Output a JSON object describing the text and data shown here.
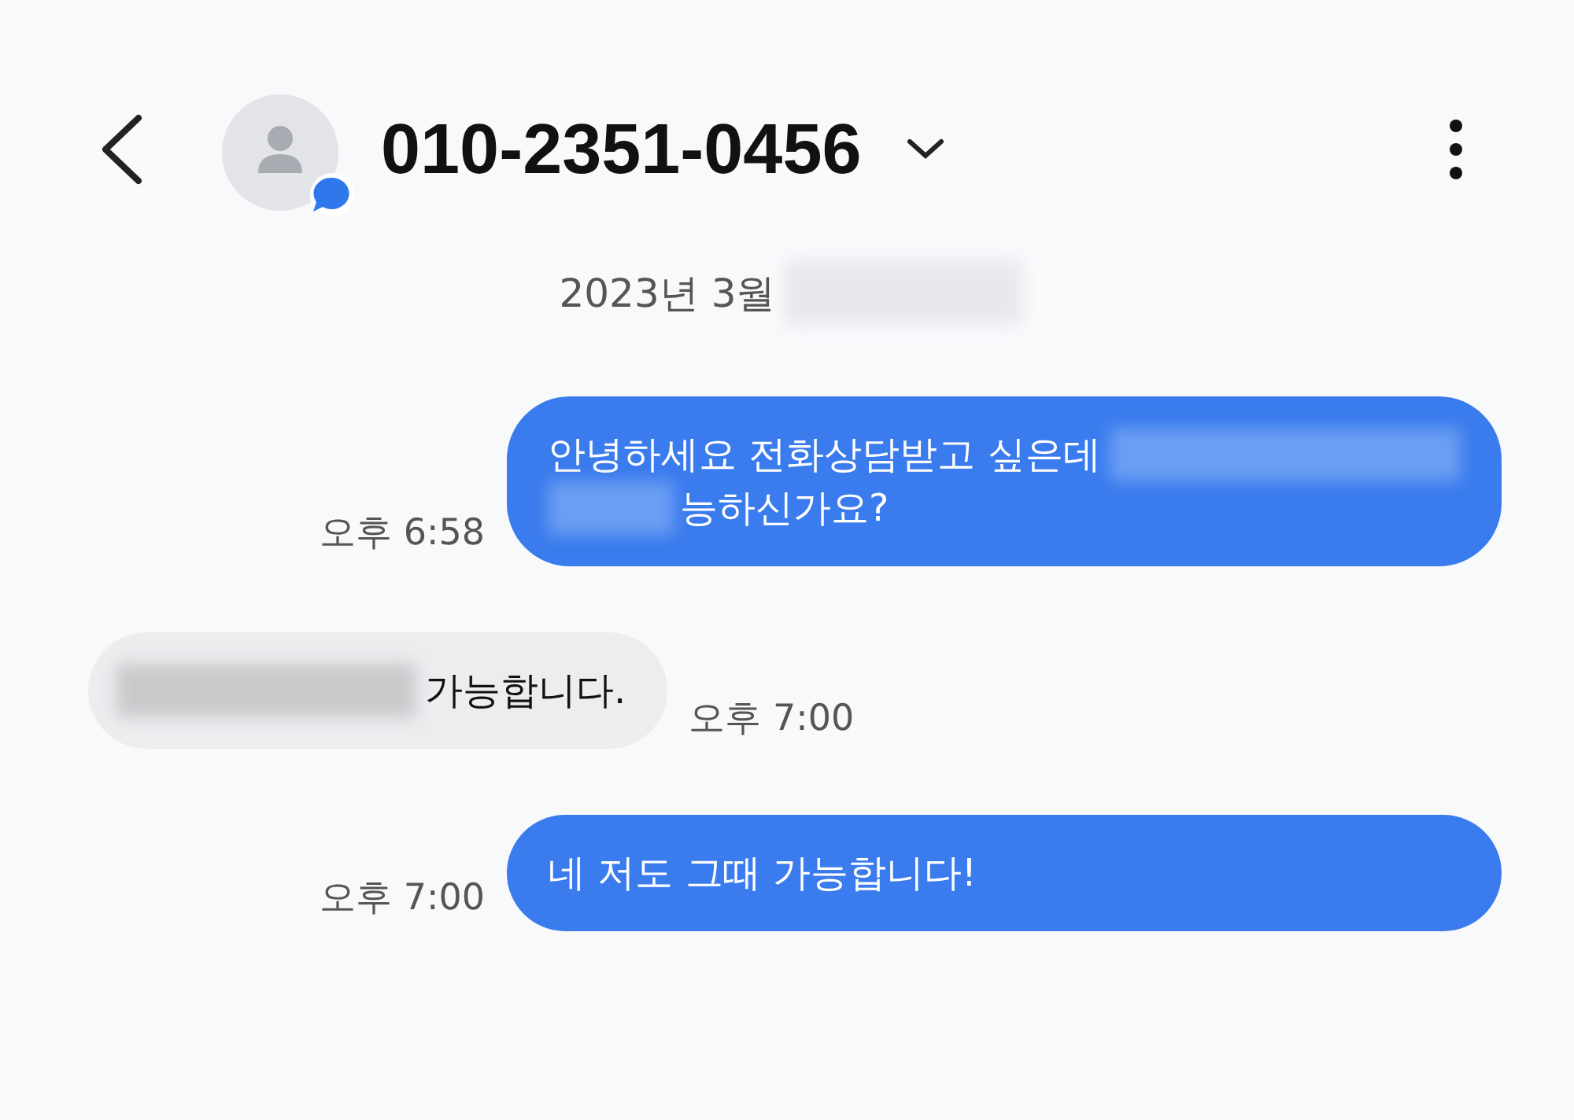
{
  "header": {
    "title": "010-2351-0456"
  },
  "date": {
    "text": "2023년 3월",
    "redacted": true
  },
  "messages": [
    {
      "kind": "sent",
      "time": "오후 6:58",
      "lines": [
        [
          {
            "kind": "text",
            "text": "안녕하세요 전화상담받고 싶은데"
          },
          {
            "kind": "redacted"
          }
        ],
        [
          {
            "kind": "redacted"
          },
          {
            "kind": "text",
            "text": "능하신가요?"
          }
        ]
      ]
    },
    {
      "kind": "received",
      "time": "오후 7:00",
      "lines": [
        [
          {
            "kind": "redacted"
          },
          {
            "kind": "text",
            "text": "가능합니다."
          }
        ]
      ]
    },
    {
      "kind": "sent",
      "time": "오후 7:00",
      "lines": [
        [
          {
            "kind": "text",
            "text": "네 저도 그때 가능합니다!"
          }
        ]
      ]
    }
  ]
}
